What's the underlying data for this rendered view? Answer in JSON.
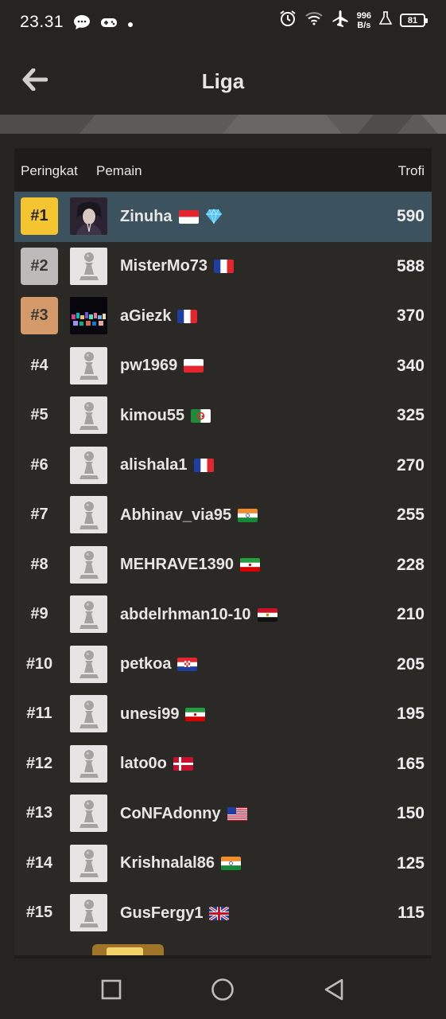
{
  "status_bar": {
    "time": "23.31",
    "net_speed_value": "996",
    "net_speed_unit": "B/s",
    "battery": "81"
  },
  "app_bar": {
    "title": "Liga"
  },
  "table": {
    "headers": {
      "rank": "Peringkat",
      "player": "Pemain",
      "trophies": "Trofi"
    },
    "rows": [
      {
        "rank": "#1",
        "name": "Zinuha",
        "flag": "Indonesia",
        "trophies": "590",
        "highlight": true,
        "badge": "diamond"
      },
      {
        "rank": "#2",
        "name": "MisterMo73",
        "flag": "France",
        "trophies": "588"
      },
      {
        "rank": "#3",
        "name": "aGiezk",
        "flag": "France",
        "trophies": "370"
      },
      {
        "rank": "#4",
        "name": "pw1969",
        "flag": "Poland",
        "trophies": "340"
      },
      {
        "rank": "#5",
        "name": "kimou55",
        "flag": "Algeria",
        "trophies": "325"
      },
      {
        "rank": "#6",
        "name": "alishala1",
        "flag": "France",
        "trophies": "270"
      },
      {
        "rank": "#7",
        "name": "Abhinav_via95",
        "flag": "India",
        "trophies": "255"
      },
      {
        "rank": "#8",
        "name": "MEHRAVE1390",
        "flag": "Iran",
        "trophies": "228"
      },
      {
        "rank": "#9",
        "name": "abdelrhman10-10",
        "flag": "Egypt",
        "trophies": "210"
      },
      {
        "rank": "#10",
        "name": "petkoa",
        "flag": "Croatia",
        "trophies": "205"
      },
      {
        "rank": "#11",
        "name": "unesi99",
        "flag": "Iran",
        "trophies": "195"
      },
      {
        "rank": "#12",
        "name": "lato0o",
        "flag": "Denmark",
        "trophies": "165"
      },
      {
        "rank": "#13",
        "name": "CoNFAdonny",
        "flag": "United States",
        "trophies": "150"
      },
      {
        "rank": "#14",
        "name": "Krishnalal86",
        "flag": "India",
        "trophies": "125"
      },
      {
        "rank": "#15",
        "name": "GusFergy1",
        "flag": "United Kingdom",
        "trophies": "115"
      }
    ]
  },
  "colors": {
    "background": "#262421",
    "highlight_row": "#3c525e",
    "gold": "#f4c431",
    "silver": "#bcbbba",
    "bronze": "#d49a6a"
  },
  "icons": {
    "back": "arrow-left-icon",
    "pawn": "pawn-icon",
    "nav_recents": "square-icon",
    "nav_home": "circle-icon",
    "nav_back": "triangle-back-icon"
  }
}
